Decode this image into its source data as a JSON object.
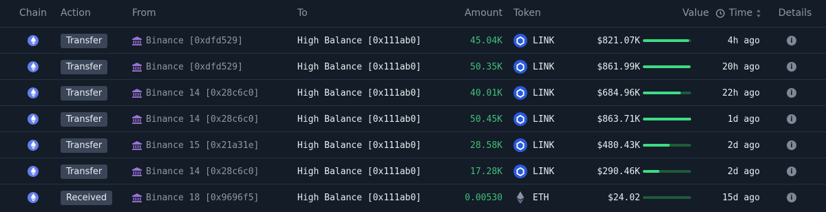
{
  "headers": {
    "chain": "Chain",
    "action": "Action",
    "from": "From",
    "to": "To",
    "amount": "Amount",
    "token": "Token",
    "value": "Value",
    "time": "Time",
    "details": "Details"
  },
  "colors": {
    "background": "#141c27",
    "amount_green": "#3fbf7a",
    "bar_fill": "#3ddc84",
    "bar_track": "#1f5a3b",
    "eth_blue": "#627eea",
    "link_blue": "#2a5ada"
  },
  "rows": [
    {
      "chain_icon": "ethereum-icon",
      "action": "Transfer",
      "from_icon": "bank-icon",
      "from": "Binance [0xdfd529]",
      "to": "High Balance [0x111ab0]",
      "amount": "45.04K",
      "token_icon": "chainlink-icon",
      "token": "LINK",
      "value": "$821.07K",
      "value_fraction": 0.95,
      "time": "4h ago",
      "details_icon": "info-icon"
    },
    {
      "chain_icon": "ethereum-icon",
      "action": "Transfer",
      "from_icon": "bank-icon",
      "from": "Binance [0xdfd529]",
      "to": "High Balance [0x111ab0]",
      "amount": "50.35K",
      "token_icon": "chainlink-icon",
      "token": "LINK",
      "value": "$861.99K",
      "value_fraction": 0.99,
      "time": "20h ago",
      "details_icon": "info-icon"
    },
    {
      "chain_icon": "ethereum-icon",
      "action": "Transfer",
      "from_icon": "bank-icon",
      "from": "Binance 14 [0x28c6c0]",
      "to": "High Balance [0x111ab0]",
      "amount": "40.01K",
      "token_icon": "chainlink-icon",
      "token": "LINK",
      "value": "$684.96K",
      "value_fraction": 0.79,
      "time": "22h ago",
      "details_icon": "info-icon"
    },
    {
      "chain_icon": "ethereum-icon",
      "action": "Transfer",
      "from_icon": "bank-icon",
      "from": "Binance 14 [0x28c6c0]",
      "to": "High Balance [0x111ab0]",
      "amount": "50.45K",
      "token_icon": "chainlink-icon",
      "token": "LINK",
      "value": "$863.71K",
      "value_fraction": 1.0,
      "time": "1d ago",
      "details_icon": "info-icon"
    },
    {
      "chain_icon": "ethereum-icon",
      "action": "Transfer",
      "from_icon": "bank-icon",
      "from": "Binance 15 [0x21a31e]",
      "to": "High Balance [0x111ab0]",
      "amount": "28.58K",
      "token_icon": "chainlink-icon",
      "token": "LINK",
      "value": "$480.43K",
      "value_fraction": 0.56,
      "time": "2d ago",
      "details_icon": "info-icon"
    },
    {
      "chain_icon": "ethereum-icon",
      "action": "Transfer",
      "from_icon": "bank-icon",
      "from": "Binance 14 [0x28c6c0]",
      "to": "High Balance [0x111ab0]",
      "amount": "17.28K",
      "token_icon": "chainlink-icon",
      "token": "LINK",
      "value": "$290.46K",
      "value_fraction": 0.34,
      "time": "2d ago",
      "details_icon": "info-icon"
    },
    {
      "chain_icon": "ethereum-icon",
      "action": "Received",
      "from_icon": "bank-icon",
      "from": "Binance 18 [0x9696f5]",
      "to": "High Balance [0x111ab0]",
      "amount": "0.00530",
      "token_icon": "ethereum-diamond-icon",
      "token": "ETH",
      "value": "$24.02",
      "value_fraction": 0.0,
      "time": "15d ago",
      "details_icon": "info-icon"
    }
  ]
}
